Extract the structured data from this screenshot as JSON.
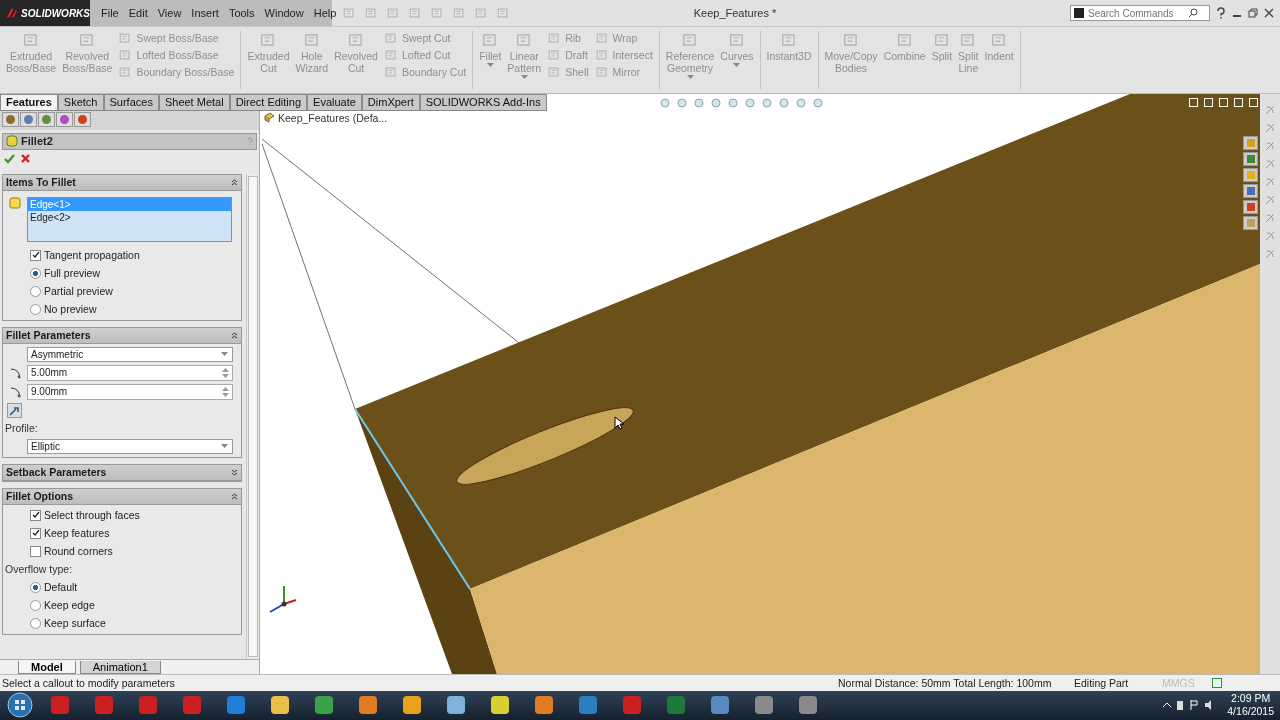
{
  "app": {
    "logo": "SOLIDWORKS",
    "menu": [
      "File",
      "Edit",
      "View",
      "Insert",
      "Tools",
      "Window",
      "Help"
    ],
    "title": "Keep_Features *",
    "search": {
      "placeholder": "Search Commands"
    }
  },
  "ribbon": {
    "groups": [
      {
        "columns": [
          {
            "kind": "large",
            "label": "Extruded\nBoss/Base"
          },
          {
            "kind": "large",
            "label": "Revolved\nBoss/Base"
          },
          {
            "kind": "small",
            "labels": [
              "Swept Boss/Base",
              "Lofted Boss/Base",
              "Boundary Boss/Base"
            ]
          }
        ]
      },
      {
        "columns": [
          {
            "kind": "large",
            "label": "Extruded\nCut"
          },
          {
            "kind": "large",
            "label": "Hole\nWizard"
          },
          {
            "kind": "large",
            "label": "Revolved\nCut"
          },
          {
            "kind": "small",
            "labels": [
              "Swept Cut",
              "Lofted Cut",
              "Boundary Cut"
            ]
          }
        ]
      },
      {
        "columns": [
          {
            "kind": "large",
            "label": "Fillet",
            "dropdown": true
          },
          {
            "kind": "large",
            "label": "Linear\nPattern",
            "dropdown": true
          },
          {
            "kind": "small",
            "labels": [
              "Rib",
              "Draft",
              "Shell"
            ]
          },
          {
            "kind": "small",
            "labels": [
              "Wrap",
              "Intersect",
              "Mirror"
            ]
          }
        ]
      },
      {
        "columns": [
          {
            "kind": "large",
            "label": "Reference\nGeometry",
            "dropdown": true
          },
          {
            "kind": "large",
            "label": "Curves",
            "dropdown": true
          }
        ]
      },
      {
        "columns": [
          {
            "kind": "large",
            "label": "Instant3D"
          }
        ]
      },
      {
        "columns": [
          {
            "kind": "large",
            "label": "Move/Copy\nBodies"
          },
          {
            "kind": "large",
            "label": "Combine"
          },
          {
            "kind": "large",
            "label": "Split"
          },
          {
            "kind": "large",
            "label": "Split\nLine"
          },
          {
            "kind": "large",
            "label": "Indent"
          }
        ]
      }
    ]
  },
  "command_tabs": [
    {
      "label": "Features",
      "selected": true
    },
    {
      "label": "Sketch",
      "selected": false
    },
    {
      "label": "Surfaces",
      "selected": false
    },
    {
      "label": "Sheet Metal",
      "selected": false
    },
    {
      "label": "Direct Editing",
      "selected": false
    },
    {
      "label": "Evaluate",
      "selected": false
    },
    {
      "label": "DimXpert",
      "selected": false
    },
    {
      "label": "SOLIDWORKS Add-Ins",
      "selected": false
    }
  ],
  "property_manager": {
    "title": "Fillet2",
    "sections": [
      {
        "title": "Items To Fillet",
        "expanded": true,
        "controls": [
          {
            "kind": "selection_list",
            "items": [
              {
                "label": "Edge<1>",
                "selected": true
              },
              {
                "label": "Edge<2>",
                "selected": false
              }
            ]
          },
          {
            "kind": "checkbox",
            "label": "Tangent propagation",
            "checked": true
          },
          {
            "kind": "radio",
            "label": "Full preview",
            "selected": true
          },
          {
            "kind": "radio",
            "label": "Partial preview",
            "selected": false
          },
          {
            "kind": "radio",
            "label": "No preview",
            "selected": false
          }
        ]
      },
      {
        "title": "Fillet Parameters",
        "expanded": true,
        "controls": [
          {
            "kind": "dropdown",
            "value": "Asymmetric"
          },
          {
            "kind": "spin",
            "value": "5.00mm"
          },
          {
            "kind": "spin",
            "value": "9.00mm"
          },
          {
            "kind": "flip_button"
          },
          {
            "kind": "label",
            "label": "Profile:"
          },
          {
            "kind": "dropdown",
            "value": "Elliptic"
          }
        ]
      },
      {
        "title": "Setback Parameters",
        "expanded": false
      },
      {
        "title": "Fillet Options",
        "expanded": true,
        "controls": [
          {
            "kind": "checkbox",
            "label": "Select through faces",
            "checked": true
          },
          {
            "kind": "checkbox",
            "label": "Keep features",
            "checked": true
          },
          {
            "kind": "checkbox",
            "label": "Round corners",
            "checked": false
          },
          {
            "kind": "label",
            "label": "Overflow type:"
          },
          {
            "kind": "radio",
            "label": "Default",
            "selected": true
          },
          {
            "kind": "radio",
            "label": "Keep edge",
            "selected": false
          },
          {
            "kind": "radio",
            "label": "Keep surface",
            "selected": false
          }
        ]
      }
    ]
  },
  "viewport": {
    "tree_label": "Keep_Features  (Defa..."
  },
  "model_tabs": [
    {
      "label": "Model",
      "selected": true
    },
    {
      "label": "Animation1",
      "selected": false
    }
  ],
  "status_bar": {
    "message": "Select a callout to modify parameters",
    "measure": "Normal Distance: 50mm Total Length: 100mm",
    "mode": "Editing Part",
    "units": "MMGS"
  },
  "taskbar": {
    "time": "2:09 PM",
    "date": "4/16/2015"
  }
}
